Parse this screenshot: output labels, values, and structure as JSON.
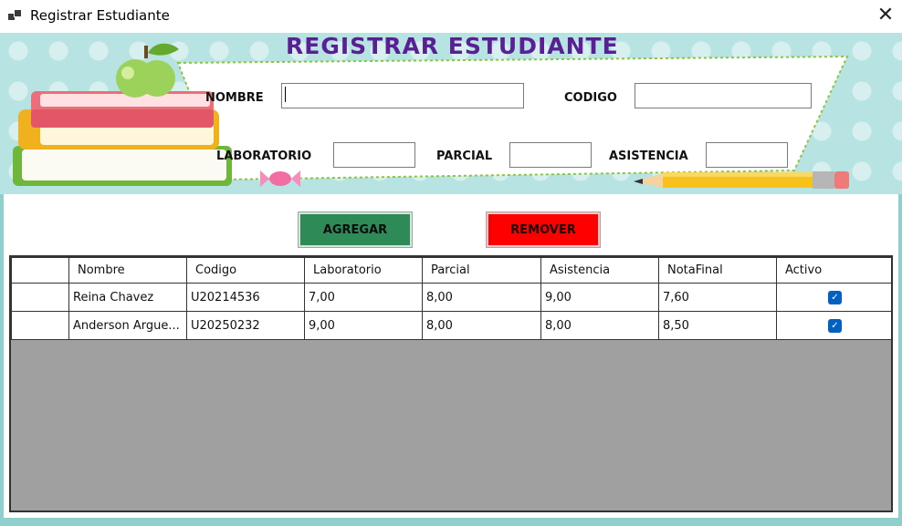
{
  "window": {
    "title": "Registrar Estudiante",
    "close_glyph": "✕"
  },
  "form": {
    "heading": "REGISTRAR ESTUDIANTE",
    "labels": {
      "nombre": "NOMBRE",
      "codigo": "CODIGO",
      "laboratorio": "LABORATORIO",
      "parcial": "PARCIAL",
      "asistencia": "ASISTENCIA"
    },
    "values": {
      "nombre": "",
      "codigo": "",
      "laboratorio": "",
      "parcial": "",
      "asistencia": ""
    }
  },
  "buttons": {
    "agregar": "AGREGAR",
    "remover": "REMOVER"
  },
  "colors": {
    "agregar": "#2e8b57",
    "remover": "#ff0000",
    "heading": "#5a1f95",
    "frame": "#8fd0cf",
    "checkbox": "#0061c2"
  },
  "table": {
    "columns": [
      "",
      "Nombre",
      "Codigo",
      "Laboratorio",
      "Parcial",
      "Asistencia",
      "NotaFinal",
      "Activo"
    ],
    "rows": [
      {
        "nombre": "Reina Chavez",
        "codigo": "U20214536",
        "laboratorio": "7,00",
        "parcial": "8,00",
        "asistencia": "9,00",
        "nota_final": "7,60",
        "activo": true
      },
      {
        "nombre": "Anderson Argue...",
        "codigo": "U20250232",
        "laboratorio": "9,00",
        "parcial": "8,00",
        "asistencia": "8,00",
        "nota_final": "8,50",
        "activo": true
      }
    ]
  }
}
